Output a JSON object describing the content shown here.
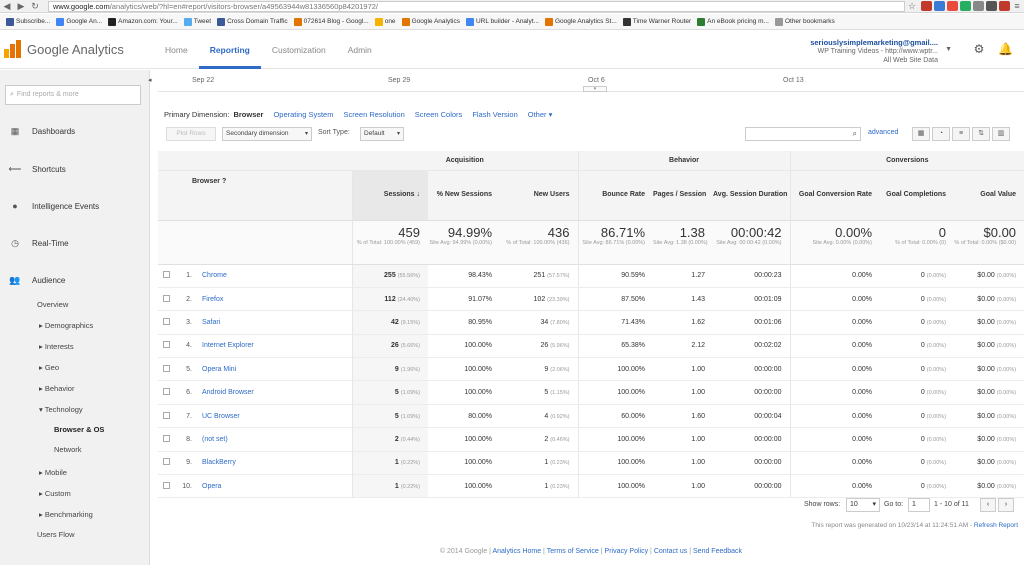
{
  "browser": {
    "url_host": "www.google.com",
    "url_path": "/analytics/web/?hl=en#report/visitors-browser/a49563944w81336560p84201972/",
    "bookmarks": [
      "Subscribe...",
      "Google An...",
      "Amazon.com: Your...",
      "Tweet",
      "Cross Domain Traffic",
      "072614 Blog - Googl...",
      "one",
      "Google Analytics",
      "URL builder - Analyt...",
      "Google Analytics St...",
      "Time Warner Router",
      "An eBook pricing m...",
      "Other bookmarks"
    ]
  },
  "header": {
    "logo_text": "Google Analytics",
    "tabs": [
      "Home",
      "Reporting",
      "Customization",
      "Admin"
    ],
    "active_tab": "Reporting",
    "account_email": "seriouslysimplemarketing@gmail....",
    "property": "WP Training Videos - http://www.wptr...",
    "view": "All Web Site Data"
  },
  "sidebar": {
    "search_placeholder": "Find reports & more",
    "sections": [
      "Dashboards",
      "Shortcuts",
      "Intelligence Events",
      "Real-Time",
      "Audience"
    ],
    "audience_items": [
      "Overview",
      "▸ Demographics",
      "▸ Interests",
      "▸ Geo",
      "▸ Behavior",
      "▾ Technology",
      "Browser & OS",
      "Network",
      "▸ Mobile",
      "▸ Custom",
      "▸ Benchmarking",
      "Users Flow"
    ]
  },
  "timeline": {
    "ticks": [
      "Sep 22",
      "Sep 29",
      "Oct 6",
      "Oct 13"
    ]
  },
  "primary_dimension": {
    "label": "Primary Dimension:",
    "current": "Browser",
    "options": [
      "Operating System",
      "Screen Resolution",
      "Screen Colors",
      "Flash Version",
      "Other ▾"
    ]
  },
  "toolbar": {
    "plot_rows": "Plot Rows",
    "secondary_dimension": "Secondary dimension",
    "sort_type_label": "Sort Type:",
    "sort_type_value": "Default",
    "advanced": "advanced"
  },
  "table": {
    "groups": [
      "Acquisition",
      "Behavior",
      "Conversions"
    ],
    "columns": [
      "Browser",
      "Sessions",
      "% New Sessions",
      "New Users",
      "Bounce Rate",
      "Pages / Session",
      "Avg. Session Duration",
      "Goal Conversion Rate",
      "Goal Completions",
      "Goal Value"
    ],
    "totals": [
      {
        "big": "459",
        "small": "% of Total: 100.00% (459)"
      },
      {
        "big": "94.99%",
        "small": "Site Avg: 94.99% (0.00%)"
      },
      {
        "big": "436",
        "small": "% of Total: 100.00% (436)"
      },
      {
        "big": "86.71%",
        "small": "Site Avg: 86.71% (0.00%)"
      },
      {
        "big": "1.38",
        "small": "Site Avg: 1.38 (0.00%)"
      },
      {
        "big": "00:00:42",
        "small": "Site Avg: 00:00:42 (0.00%)"
      },
      {
        "big": "0.00%",
        "small": "Site Avg: 0.00% (0.00%)"
      },
      {
        "big": "0",
        "small": "% of Total: 0.00% (0)"
      },
      {
        "big": "$0.00",
        "small": "% of Total: 0.00% ($0.00)"
      }
    ],
    "rows": [
      {
        "n": "1.",
        "name": "Chrome",
        "sessions": "255",
        "sess_pct": "(55.56%)",
        "new_sess": "98.43%",
        "new_users": "251",
        "nu_pct": "(57.57%)",
        "bounce": "90.59%",
        "pages": "1.27",
        "dur": "00:00:23",
        "gcr": "0.00%",
        "gc": "0",
        "gc_pct": "(0.00%)",
        "gv": "$0.00",
        "gv_pct": "(0.00%)"
      },
      {
        "n": "2.",
        "name": "Firefox",
        "sessions": "112",
        "sess_pct": "(24.40%)",
        "new_sess": "91.07%",
        "new_users": "102",
        "nu_pct": "(23.39%)",
        "bounce": "87.50%",
        "pages": "1.43",
        "dur": "00:01:09",
        "gcr": "0.00%",
        "gc": "0",
        "gc_pct": "(0.00%)",
        "gv": "$0.00",
        "gv_pct": "(0.00%)"
      },
      {
        "n": "3.",
        "name": "Safari",
        "sessions": "42",
        "sess_pct": "(9.15%)",
        "new_sess": "80.95%",
        "new_users": "34",
        "nu_pct": "(7.80%)",
        "bounce": "71.43%",
        "pages": "1.62",
        "dur": "00:01:06",
        "gcr": "0.00%",
        "gc": "0",
        "gc_pct": "(0.00%)",
        "gv": "$0.00",
        "gv_pct": "(0.00%)"
      },
      {
        "n": "4.",
        "name": "Internet Explorer",
        "sessions": "26",
        "sess_pct": "(5.66%)",
        "new_sess": "100.00%",
        "new_users": "26",
        "nu_pct": "(5.96%)",
        "bounce": "65.38%",
        "pages": "2.12",
        "dur": "00:02:02",
        "gcr": "0.00%",
        "gc": "0",
        "gc_pct": "(0.00%)",
        "gv": "$0.00",
        "gv_pct": "(0.00%)"
      },
      {
        "n": "5.",
        "name": "Opera Mini",
        "sessions": "9",
        "sess_pct": "(1.96%)",
        "new_sess": "100.00%",
        "new_users": "9",
        "nu_pct": "(2.06%)",
        "bounce": "100.00%",
        "pages": "1.00",
        "dur": "00:00:00",
        "gcr": "0.00%",
        "gc": "0",
        "gc_pct": "(0.00%)",
        "gv": "$0.00",
        "gv_pct": "(0.00%)"
      },
      {
        "n": "6.",
        "name": "Android Browser",
        "sessions": "5",
        "sess_pct": "(1.09%)",
        "new_sess": "100.00%",
        "new_users": "5",
        "nu_pct": "(1.15%)",
        "bounce": "100.00%",
        "pages": "1.00",
        "dur": "00:00:00",
        "gcr": "0.00%",
        "gc": "0",
        "gc_pct": "(0.00%)",
        "gv": "$0.00",
        "gv_pct": "(0.00%)"
      },
      {
        "n": "7.",
        "name": "UC Browser",
        "sessions": "5",
        "sess_pct": "(1.09%)",
        "new_sess": "80.00%",
        "new_users": "4",
        "nu_pct": "(0.92%)",
        "bounce": "60.00%",
        "pages": "1.60",
        "dur": "00:00:04",
        "gcr": "0.00%",
        "gc": "0",
        "gc_pct": "(0.00%)",
        "gv": "$0.00",
        "gv_pct": "(0.00%)"
      },
      {
        "n": "8.",
        "name": "(not set)",
        "sessions": "2",
        "sess_pct": "(0.44%)",
        "new_sess": "100.00%",
        "new_users": "2",
        "nu_pct": "(0.46%)",
        "bounce": "100.00%",
        "pages": "1.00",
        "dur": "00:00:00",
        "gcr": "0.00%",
        "gc": "0",
        "gc_pct": "(0.00%)",
        "gv": "$0.00",
        "gv_pct": "(0.00%)"
      },
      {
        "n": "9.",
        "name": "BlackBerry",
        "sessions": "1",
        "sess_pct": "(0.22%)",
        "new_sess": "100.00%",
        "new_users": "1",
        "nu_pct": "(0.23%)",
        "bounce": "100.00%",
        "pages": "1.00",
        "dur": "00:00:00",
        "gcr": "0.00%",
        "gc": "0",
        "gc_pct": "(0.00%)",
        "gv": "$0.00",
        "gv_pct": "(0.00%)"
      },
      {
        "n": "10.",
        "name": "Opera",
        "sessions": "1",
        "sess_pct": "(0.22%)",
        "new_sess": "100.00%",
        "new_users": "1",
        "nu_pct": "(0.23%)",
        "bounce": "100.00%",
        "pages": "1.00",
        "dur": "00:00:00",
        "gcr": "0.00%",
        "gc": "0",
        "gc_pct": "(0.00%)",
        "gv": "$0.00",
        "gv_pct": "(0.00%)"
      }
    ]
  },
  "pager": {
    "show_rows_label": "Show rows:",
    "show_rows_value": "10",
    "goto_label": "Go to:",
    "goto_value": "1",
    "range": "1 - 10 of 11"
  },
  "generated": {
    "text": "This report was generated on 10/23/14 at 11:24:51 AM -",
    "link": "Refresh Report"
  },
  "footer": {
    "copyright": "© 2014 Google",
    "links": [
      "Analytics Home",
      "Terms of Service",
      "Privacy Policy",
      "Contact us",
      "Send Feedback"
    ]
  },
  "colors": {
    "accent": "#2e6bc7",
    "logo_orange": "#e37400"
  }
}
